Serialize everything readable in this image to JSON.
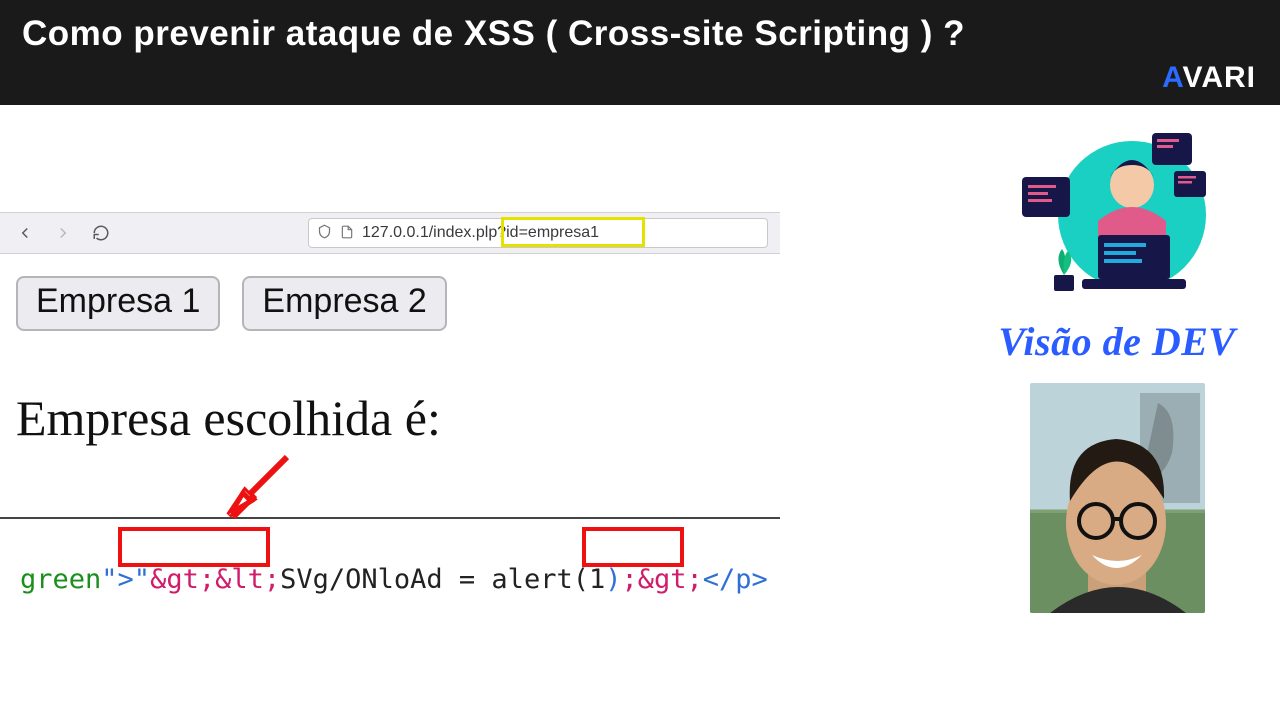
{
  "banner": {
    "title": "Como prevenir ataque de XSS ( Cross-site Scripting ) ?",
    "logo_first": "A",
    "logo_rest": "VARI"
  },
  "channel": {
    "name": "Visão de DEV"
  },
  "browser": {
    "url_prefix": "127.0.0.1/index.pl",
    "url_highlighted": "p?id=empresa1"
  },
  "page": {
    "buttons": [
      "Empresa 1",
      "Empresa 2"
    ],
    "headline": "Empresa escolhida é:"
  },
  "code": {
    "seg_attr": "green",
    "seg_open": "\">\"",
    "seg_ent1": "&gt;&lt;",
    "seg_mid": "SVg/ONloAd = alert(1",
    "seg_paren": ")",
    "seg_ent2": ";&gt;",
    "seg_close": "</p>"
  }
}
